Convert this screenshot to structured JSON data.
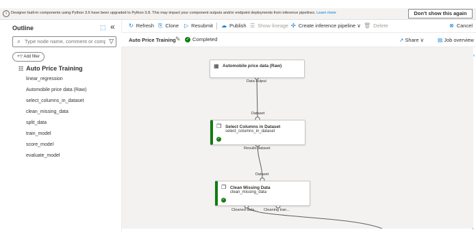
{
  "banner": {
    "message": "Designer built-in components using Python 3.6 have been upgraded to Python 3.8. This may impact your component outputs and/or endpoint deployments from inference pipelines.",
    "learn_more": "Learn more",
    "dismiss_label": "Don't show this again"
  },
  "outline": {
    "title": "Outline",
    "search_placeholder": "Type node name, comment or comp...",
    "add_filter": "Add filter",
    "pipeline_name": "Auto Price Training",
    "items": [
      {
        "label": "linear_regression"
      },
      {
        "label": "Automobile price data (Raw)"
      },
      {
        "label": "select_columns_in_dataset"
      },
      {
        "label": "clean_missing_data"
      },
      {
        "label": "split_data"
      },
      {
        "label": "train_model"
      },
      {
        "label": "score_model"
      },
      {
        "label": "evaluate_model"
      }
    ]
  },
  "toolbar": {
    "refresh": "Refresh",
    "clone": "Clone",
    "resubmit": "Resubmit",
    "publish": "Publish",
    "show_lineage": "Show lineage",
    "create_inference": "Create inference pipeline",
    "delete": "Delete",
    "cancel": "Cancel"
  },
  "subheader": {
    "run_name": "Auto Price Training",
    "status": "Completed",
    "share": "Share",
    "job_overview": "Job overview"
  },
  "canvas": {
    "nodes": [
      {
        "title": "Automobile price data (Raw)",
        "subtitle": ""
      },
      {
        "title": "Select Columns in Dataset",
        "subtitle": "select_columns_in_dataset"
      },
      {
        "title": "Clean Missing Data",
        "subtitle": "clean_missing_data"
      }
    ],
    "ports": {
      "n1_out": "Data output",
      "n2_in": "Dataset",
      "n2_out": "Results dataset",
      "n3_in": "Dataset",
      "n3_out1": "Cleaned data...",
      "n3_out2": "Cleaning tran..."
    }
  },
  "colors": {
    "accent": "#0078d4",
    "success": "#107c10",
    "canvas_bg": "#f3f2f1"
  }
}
